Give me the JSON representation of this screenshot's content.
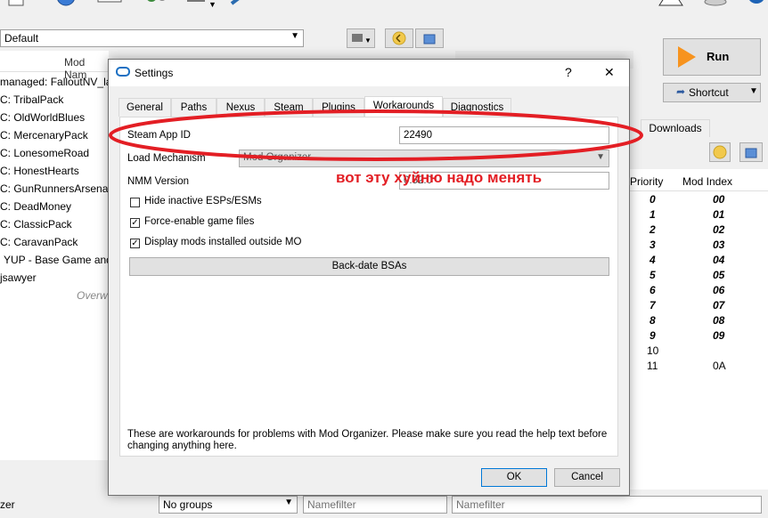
{
  "main": {
    "profile": "Default",
    "list_header": "Mod Nam",
    "mods": [
      "managed: FalloutNV_la",
      "C: TribalPack",
      "C: OldWorldBlues",
      "C: MercenaryPack",
      "C: LonesomeRoad",
      "C: HonestHearts",
      "C: GunRunnersArsenal",
      "C: DeadMoney",
      "C: ClassicPack",
      "C: CaravanPack",
      "YUP - Base Game and",
      "jsawyer"
    ],
    "overwrite_label": "Overw",
    "run_label": "Run",
    "shortcut_label": "Shortcut",
    "downloads_tab": "Downloads",
    "priority_header": "Priority",
    "mod_index_header": "Mod Index",
    "plugins": [
      {
        "priority": "0",
        "index": "00"
      },
      {
        "priority": "1",
        "index": "01"
      },
      {
        "priority": "2",
        "index": "02"
      },
      {
        "priority": "3",
        "index": "03"
      },
      {
        "priority": "4",
        "index": "04"
      },
      {
        "priority": "5",
        "index": "05"
      },
      {
        "priority": "6",
        "index": "06"
      },
      {
        "priority": "7",
        "index": "07"
      },
      {
        "priority": "8",
        "index": "08"
      },
      {
        "priority": "9",
        "index": "09"
      },
      {
        "priority": "10",
        "index": ""
      },
      {
        "priority": "11",
        "index": "0A"
      }
    ],
    "filter_label": "zer",
    "groups_value": "No groups",
    "namefilter_placeholder": "Namefilter"
  },
  "dialog": {
    "title": "Settings",
    "help_glyph": "?",
    "close_glyph": "✕",
    "tabs": [
      "General",
      "Paths",
      "Nexus",
      "Steam",
      "Plugins",
      "Workarounds",
      "Diagnostics"
    ],
    "steam_app_id_label": "Steam App ID",
    "steam_app_id_value": "22490",
    "load_mechanism_label": "Load Mechanism",
    "load_mechanism_value": "Mod Organizer",
    "nmm_version_label": "NMM Version",
    "nmm_version_value": "0.52.0",
    "hide_inactive_label": "Hide inactive ESPs/ESMs",
    "force_enable_label": "Force-enable game files",
    "display_mods_label": "Display mods installed outside MO",
    "backdate_label": "Back-date BSAs",
    "info_text": "These are workarounds for problems with Mod Organizer. Please make sure you read the help text before changing anything here.",
    "ok_label": "OK",
    "cancel_label": "Cancel"
  },
  "annotation": {
    "text": "вот эту хуйню надо менять",
    "color": "#e31e24"
  },
  "colors": {
    "accent": "#0078d7",
    "run_icon": "#f7931e"
  }
}
